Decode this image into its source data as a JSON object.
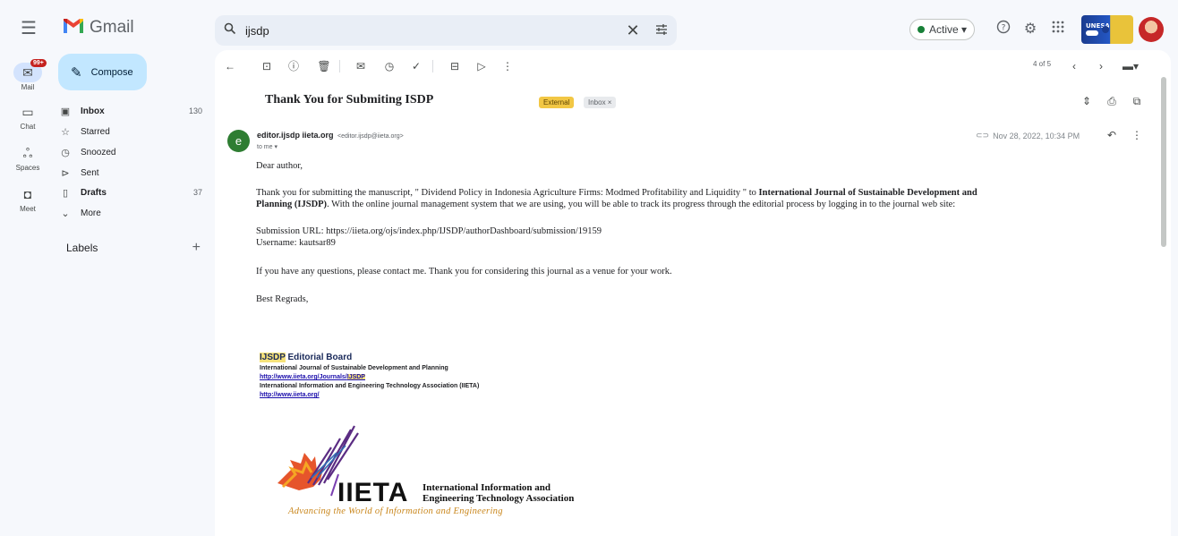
{
  "app": {
    "name": "Gmail"
  },
  "search": {
    "value": "ijsdp"
  },
  "header": {
    "status_label": "Active ▾"
  },
  "rail": {
    "mail_badge": "99+",
    "items": [
      {
        "label": "Mail"
      },
      {
        "label": "Chat"
      },
      {
        "label": "Spaces"
      },
      {
        "label": "Meet"
      }
    ]
  },
  "nav": {
    "compose_label": "Compose",
    "items": [
      {
        "label": "Inbox",
        "count": "130"
      },
      {
        "label": "Starred",
        "count": ""
      },
      {
        "label": "Snoozed",
        "count": ""
      },
      {
        "label": "Sent",
        "count": ""
      },
      {
        "label": "Drafts",
        "count": "37"
      },
      {
        "label": "More",
        "count": ""
      }
    ],
    "labels_heading": "Labels"
  },
  "toolbar": {
    "pager": "4 of 5"
  },
  "email": {
    "subject": "Thank You for Submiting ISDP",
    "chips": {
      "external": "External",
      "inbox": "Inbox ×"
    },
    "sender_initial": "e",
    "sender_name": "editor.ijsdp iieta.org",
    "sender_address": "<editor.ijsdp@iieta.org>",
    "to": "to me ▾",
    "date": "Nov 28, 2022, 10:34 PM",
    "greeting": "Dear author,",
    "para1_a": "Thank you for submitting the manuscript, \" Dividend Policy in Indonesia Agriculture Firms: Modmed Profitability and Liquidity \" to ",
    "para1_journal": "International Journal of Sustainable Development and",
    "para1_journal2": "Planning (IJSDP)",
    "para1_b": ". With the online journal management system that we are using, you will be able to track its progress through the editorial process by logging in to the journal web site:",
    "submission_url": "Submission URL: https://iieta.org/ojs/index.php/IJSDP/authorDashboard/submission/19159",
    "username": "Username: kautsar89",
    "para3": "If you have any questions, please contact me. Thank you for considering this journal as a venue for your work.",
    "closing": "Best Regrads,"
  },
  "signature": {
    "title_hl": "IJSDP",
    "title_rest": " Editorial Board",
    "journal": "International Journal of Sustainable Development and Planning",
    "link1_a": "http://www.iieta.org/Journals/",
    "link1_hl": "IJSDP",
    "assoc": "International Information and Engineering Technology Association (IIETA)",
    "link2": "http://www.iieta.org/"
  },
  "iieta_logo": {
    "name": "IIETA",
    "full1": "International Information and",
    "full2": "Engineering Technology Association",
    "tagline": "Advancing the World of Information and Engineering"
  },
  "colors": {
    "accent": "#c2e7ff",
    "external_chip": "#f2c744",
    "avatar": "#2e7d32"
  }
}
